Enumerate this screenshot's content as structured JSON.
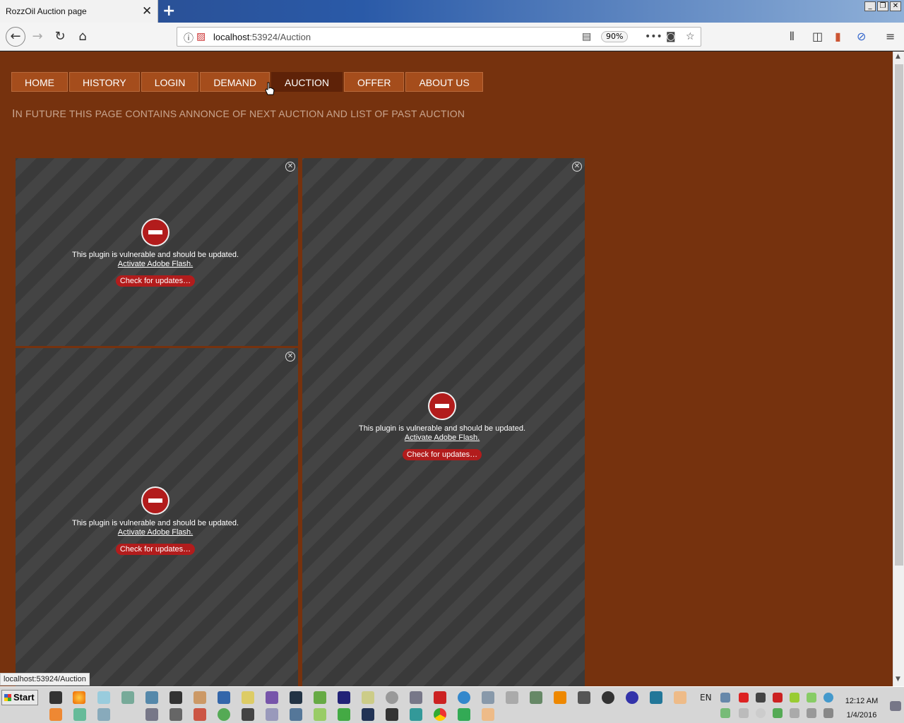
{
  "browser": {
    "tab_title": "RozzOil Auction page",
    "tab_close": "✕",
    "new_tab": "+",
    "url_host": "localhost",
    "url_rest": ":53924/Auction",
    "zoom": "90%",
    "status_url": "localhost:53924/Auction"
  },
  "menu": {
    "items": [
      "HOME",
      "HISTORY",
      "LOGIN",
      "DEMAND",
      "AUCTION",
      "OFFER",
      "ABOUT US"
    ],
    "active": "AUCTION"
  },
  "page": {
    "subtitle_first": "I",
    "subtitle_rest": "N FUTURE THIS PAGE CONTAINS ANNONCE OF NEXT AUCTION AND LIST OF PAST AUCTION"
  },
  "plugin": {
    "message": "This plugin is vulnerable and should be updated.",
    "activate": "Activate Adobe Flash.",
    "check": "Check for updates…",
    "close": "✕"
  },
  "taskbar": {
    "start": "Start",
    "lang": "EN",
    "time": "12:12 AM",
    "date": "1/4/2016"
  },
  "colors": {
    "page_bg": "#76320e",
    "menu_bg": "#a54d1c",
    "menu_active": "#5e2208",
    "plugin_red": "#b21c1c"
  }
}
